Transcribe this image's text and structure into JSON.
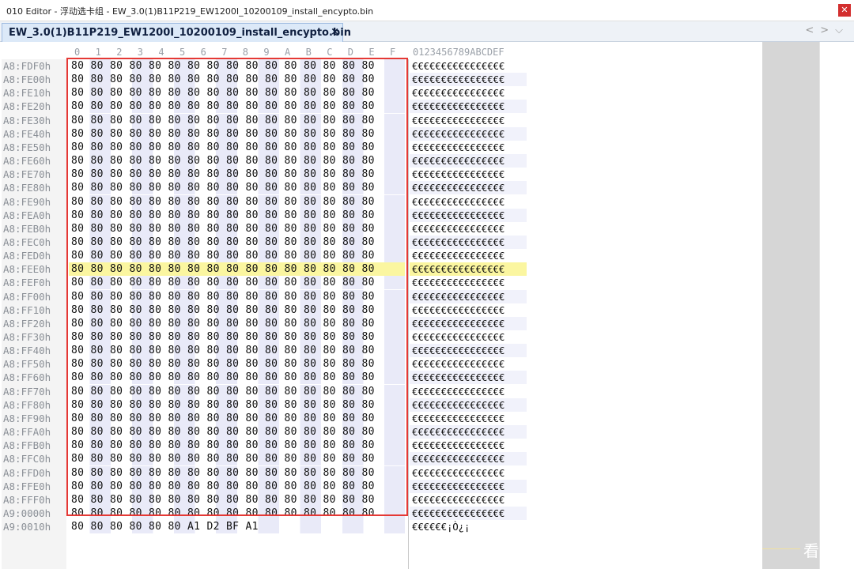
{
  "window": {
    "title": "010 Editor - 浮动选卡组 - EW_3.0(1)B11P219_EW1200I_10200109_install_encypto.bin"
  },
  "tab": {
    "label": "EW_3.0(1)B11P219_EW1200I_10200109_install_encypto.bin",
    "close_glyph": "×"
  },
  "nav": {
    "prev": "<",
    "next": ">",
    "menu": "⌵"
  },
  "header": {
    "hex_columns": [
      "0",
      "1",
      "2",
      "3",
      "4",
      "5",
      "6",
      "7",
      "8",
      "9",
      "A",
      "B",
      "C",
      "D",
      "E",
      "F"
    ],
    "ascii_header": "0123456789ABCDEF"
  },
  "rows": [
    {
      "addr": "A8:FDF0h",
      "hex": "80 80 80 80 80 80 80 80 80 80 80 80 80 80 80 80",
      "ascii": "€€€€€€€€€€€€€€€€"
    },
    {
      "addr": "A8:FE00h",
      "hex": "80 80 80 80 80 80 80 80 80 80 80 80 80 80 80 80",
      "ascii": "€€€€€€€€€€€€€€€€"
    },
    {
      "addr": "A8:FE10h",
      "hex": "80 80 80 80 80 80 80 80 80 80 80 80 80 80 80 80",
      "ascii": "€€€€€€€€€€€€€€€€"
    },
    {
      "addr": "A8:FE20h",
      "hex": "80 80 80 80 80 80 80 80 80 80 80 80 80 80 80 80",
      "ascii": "€€€€€€€€€€€€€€€€"
    },
    {
      "addr": "A8:FE30h",
      "hex": "80 80 80 80 80 80 80 80 80 80 80 80 80 80 80 80",
      "ascii": "€€€€€€€€€€€€€€€€"
    },
    {
      "addr": "A8:FE40h",
      "hex": "80 80 80 80 80 80 80 80 80 80 80 80 80 80 80 80",
      "ascii": "€€€€€€€€€€€€€€€€"
    },
    {
      "addr": "A8:FE50h",
      "hex": "80 80 80 80 80 80 80 80 80 80 80 80 80 80 80 80",
      "ascii": "€€€€€€€€€€€€€€€€"
    },
    {
      "addr": "A8:FE60h",
      "hex": "80 80 80 80 80 80 80 80 80 80 80 80 80 80 80 80",
      "ascii": "€€€€€€€€€€€€€€€€"
    },
    {
      "addr": "A8:FE70h",
      "hex": "80 80 80 80 80 80 80 80 80 80 80 80 80 80 80 80",
      "ascii": "€€€€€€€€€€€€€€€€"
    },
    {
      "addr": "A8:FE80h",
      "hex": "80 80 80 80 80 80 80 80 80 80 80 80 80 80 80 80",
      "ascii": "€€€€€€€€€€€€€€€€"
    },
    {
      "addr": "A8:FE90h",
      "hex": "80 80 80 80 80 80 80 80 80 80 80 80 80 80 80 80",
      "ascii": "€€€€€€€€€€€€€€€€"
    },
    {
      "addr": "A8:FEA0h",
      "hex": "80 80 80 80 80 80 80 80 80 80 80 80 80 80 80 80",
      "ascii": "€€€€€€€€€€€€€€€€"
    },
    {
      "addr": "A8:FEB0h",
      "hex": "80 80 80 80 80 80 80 80 80 80 80 80 80 80 80 80",
      "ascii": "€€€€€€€€€€€€€€€€"
    },
    {
      "addr": "A8:FEC0h",
      "hex": "80 80 80 80 80 80 80 80 80 80 80 80 80 80 80 80",
      "ascii": "€€€€€€€€€€€€€€€€"
    },
    {
      "addr": "A8:FED0h",
      "hex": "80 80 80 80 80 80 80 80 80 80 80 80 80 80 80 80",
      "ascii": "€€€€€€€€€€€€€€€€"
    },
    {
      "addr": "A8:FEE0h",
      "hex": "80 80 80 80 80 80 80 80 80 80 80 80 80 80 80 80",
      "ascii": "€€€€€€€€€€€€€€€€",
      "highlight": true
    },
    {
      "addr": "A8:FEF0h",
      "hex": "80 80 80 80 80 80 80 80 80 80 80 80 80 80 80 80",
      "ascii": "€€€€€€€€€€€€€€€€"
    },
    {
      "addr": "A8:FF00h",
      "hex": "80 80 80 80 80 80 80 80 80 80 80 80 80 80 80 80",
      "ascii": "€€€€€€€€€€€€€€€€"
    },
    {
      "addr": "A8:FF10h",
      "hex": "80 80 80 80 80 80 80 80 80 80 80 80 80 80 80 80",
      "ascii": "€€€€€€€€€€€€€€€€"
    },
    {
      "addr": "A8:FF20h",
      "hex": "80 80 80 80 80 80 80 80 80 80 80 80 80 80 80 80",
      "ascii": "€€€€€€€€€€€€€€€€"
    },
    {
      "addr": "A8:FF30h",
      "hex": "80 80 80 80 80 80 80 80 80 80 80 80 80 80 80 80",
      "ascii": "€€€€€€€€€€€€€€€€"
    },
    {
      "addr": "A8:FF40h",
      "hex": "80 80 80 80 80 80 80 80 80 80 80 80 80 80 80 80",
      "ascii": "€€€€€€€€€€€€€€€€"
    },
    {
      "addr": "A8:FF50h",
      "hex": "80 80 80 80 80 80 80 80 80 80 80 80 80 80 80 80",
      "ascii": "€€€€€€€€€€€€€€€€"
    },
    {
      "addr": "A8:FF60h",
      "hex": "80 80 80 80 80 80 80 80 80 80 80 80 80 80 80 80",
      "ascii": "€€€€€€€€€€€€€€€€"
    },
    {
      "addr": "A8:FF70h",
      "hex": "80 80 80 80 80 80 80 80 80 80 80 80 80 80 80 80",
      "ascii": "€€€€€€€€€€€€€€€€"
    },
    {
      "addr": "A8:FF80h",
      "hex": "80 80 80 80 80 80 80 80 80 80 80 80 80 80 80 80",
      "ascii": "€€€€€€€€€€€€€€€€"
    },
    {
      "addr": "A8:FF90h",
      "hex": "80 80 80 80 80 80 80 80 80 80 80 80 80 80 80 80",
      "ascii": "€€€€€€€€€€€€€€€€"
    },
    {
      "addr": "A8:FFA0h",
      "hex": "80 80 80 80 80 80 80 80 80 80 80 80 80 80 80 80",
      "ascii": "€€€€€€€€€€€€€€€€"
    },
    {
      "addr": "A8:FFB0h",
      "hex": "80 80 80 80 80 80 80 80 80 80 80 80 80 80 80 80",
      "ascii": "€€€€€€€€€€€€€€€€"
    },
    {
      "addr": "A8:FFC0h",
      "hex": "80 80 80 80 80 80 80 80 80 80 80 80 80 80 80 80",
      "ascii": "€€€€€€€€€€€€€€€€"
    },
    {
      "addr": "A8:FFD0h",
      "hex": "80 80 80 80 80 80 80 80 80 80 80 80 80 80 80 80",
      "ascii": "€€€€€€€€€€€€€€€€"
    },
    {
      "addr": "A8:FFE0h",
      "hex": "80 80 80 80 80 80 80 80 80 80 80 80 80 80 80 80",
      "ascii": "€€€€€€€€€€€€€€€€"
    },
    {
      "addr": "A8:FFF0h",
      "hex": "80 80 80 80 80 80 80 80 80 80 80 80 80 80 80 80",
      "ascii": "€€€€€€€€€€€€€€€€"
    },
    {
      "addr": "A9:0000h",
      "hex": "80 80 80 80 80 80 80 80 80 80 80 80 80 80 80 80",
      "ascii": "€€€€€€€€€€€€€€€€"
    },
    {
      "addr": "A9:0010h",
      "hex": "80 80 80 80 80 80 A1 D2 BF A1",
      "ascii": "€€€€€€¡Ò¿¡"
    }
  ],
  "watermark": "看雪",
  "colors": {
    "selection_border": "#e53935",
    "highlight_row": "#fbf6a0",
    "alt_cell": "#e9eaf8"
  }
}
